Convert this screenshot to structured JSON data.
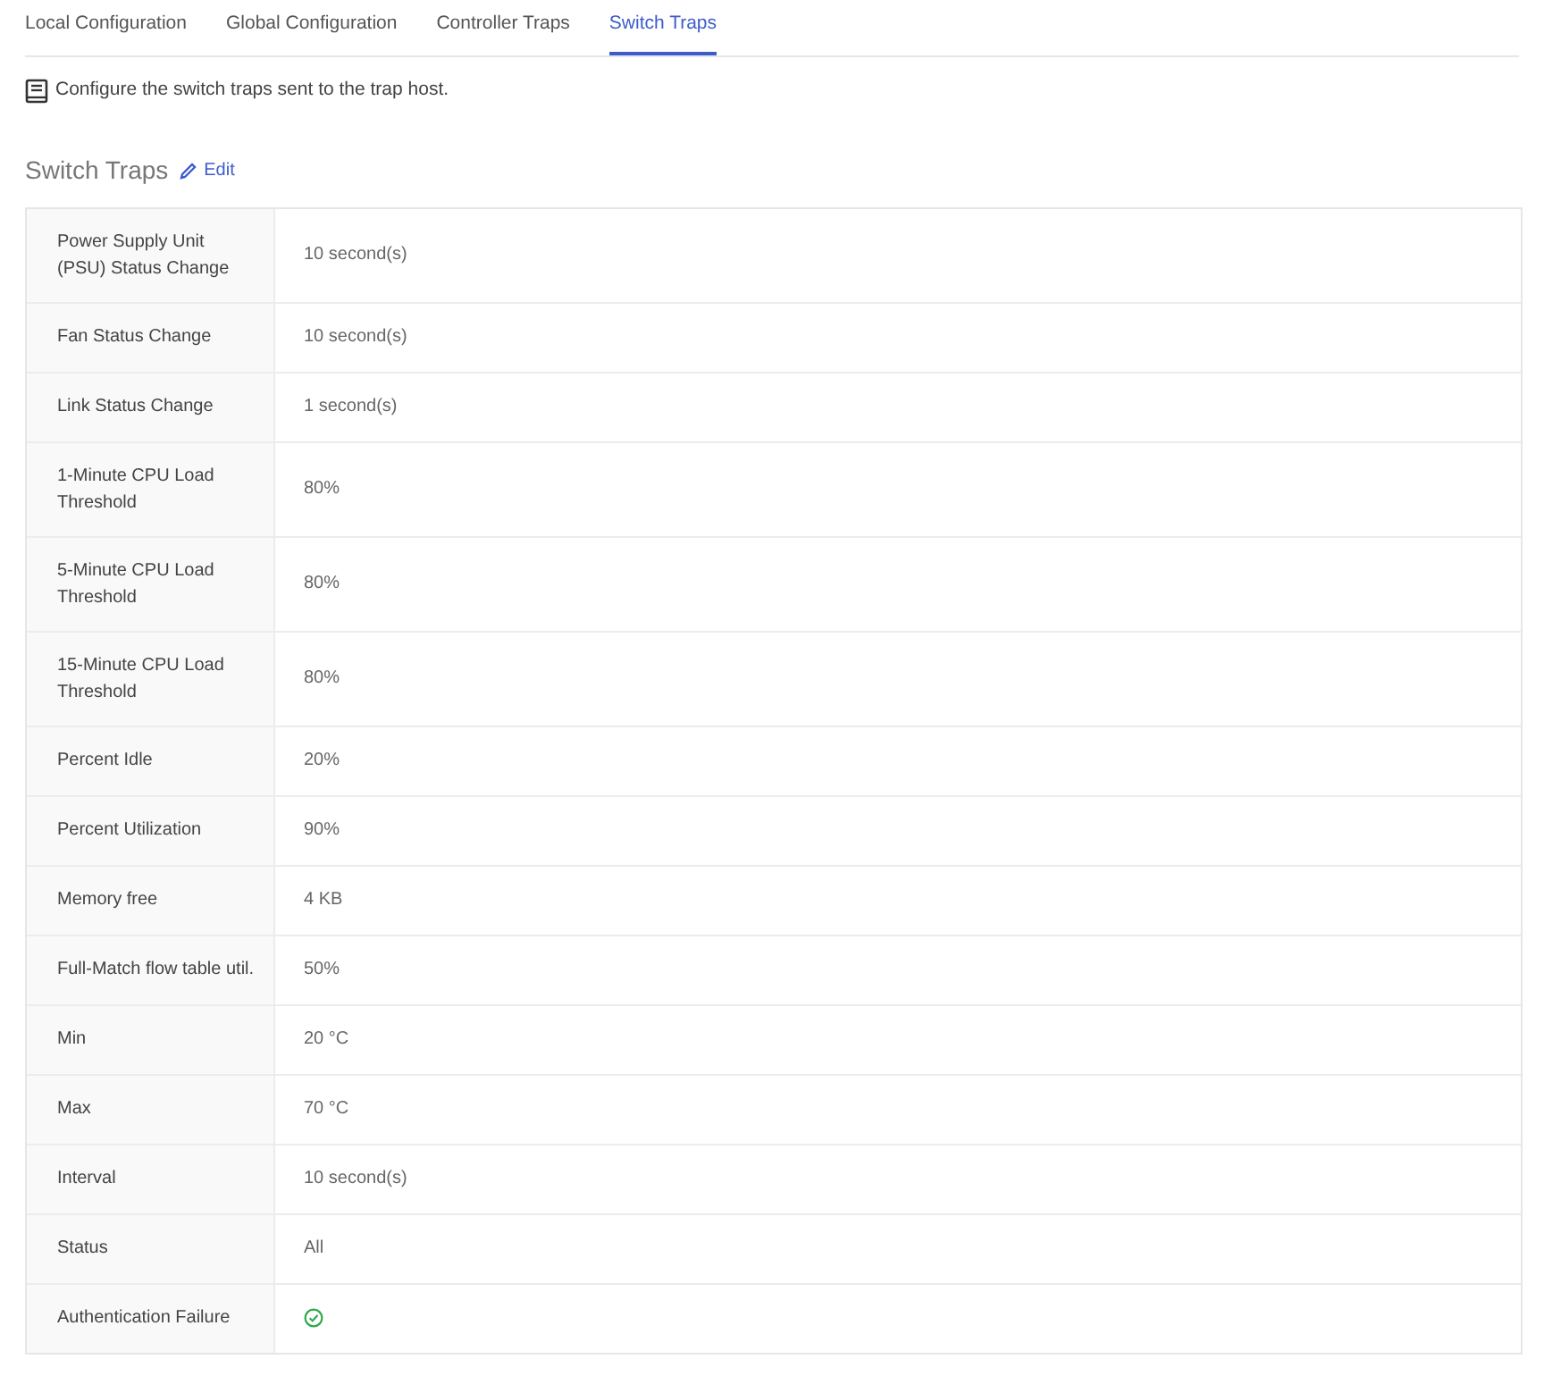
{
  "tabs": [
    {
      "label": "Local Configuration",
      "selected": false
    },
    {
      "label": "Global Configuration",
      "selected": false
    },
    {
      "label": "Controller Traps",
      "selected": false
    },
    {
      "label": "Switch Traps",
      "selected": true
    }
  ],
  "description": "Configure the switch traps sent to the trap host.",
  "section": {
    "title": "Switch Traps",
    "edit_link": "Edit"
  },
  "rows": [
    {
      "label": "Power Supply Unit (PSU) Status Change",
      "kind": "text",
      "value": "10 second(s)"
    },
    {
      "label": "Fan Status Change",
      "kind": "text",
      "value": "10 second(s)"
    },
    {
      "label": "Link Status Change",
      "kind": "text",
      "value": "1 second(s)"
    },
    {
      "label": "1-Minute CPU Load Threshold",
      "kind": "text",
      "value": "80%"
    },
    {
      "label": "5-Minute CPU Load Threshold",
      "kind": "text",
      "value": "80%"
    },
    {
      "label": "15-Minute CPU Load Threshold",
      "kind": "text",
      "value": "80%"
    },
    {
      "label": "Percent Idle",
      "kind": "text",
      "value": "20%"
    },
    {
      "label": "Percent Utilization",
      "kind": "text",
      "value": "90%"
    },
    {
      "label": "Memory free",
      "kind": "text",
      "value": "4 KB"
    },
    {
      "label": "Full-Match flow table util.",
      "kind": "text",
      "value": "50%"
    },
    {
      "label": "Min",
      "kind": "text",
      "value": "20 °C"
    },
    {
      "label": "Max",
      "kind": "text",
      "value": "70 °C"
    },
    {
      "label": "Interval",
      "kind": "text",
      "value": "10 second(s)"
    },
    {
      "label": "Status",
      "kind": "text",
      "value": "All"
    },
    {
      "label": "Authentication Failure",
      "kind": "check",
      "checked": true
    }
  ]
}
